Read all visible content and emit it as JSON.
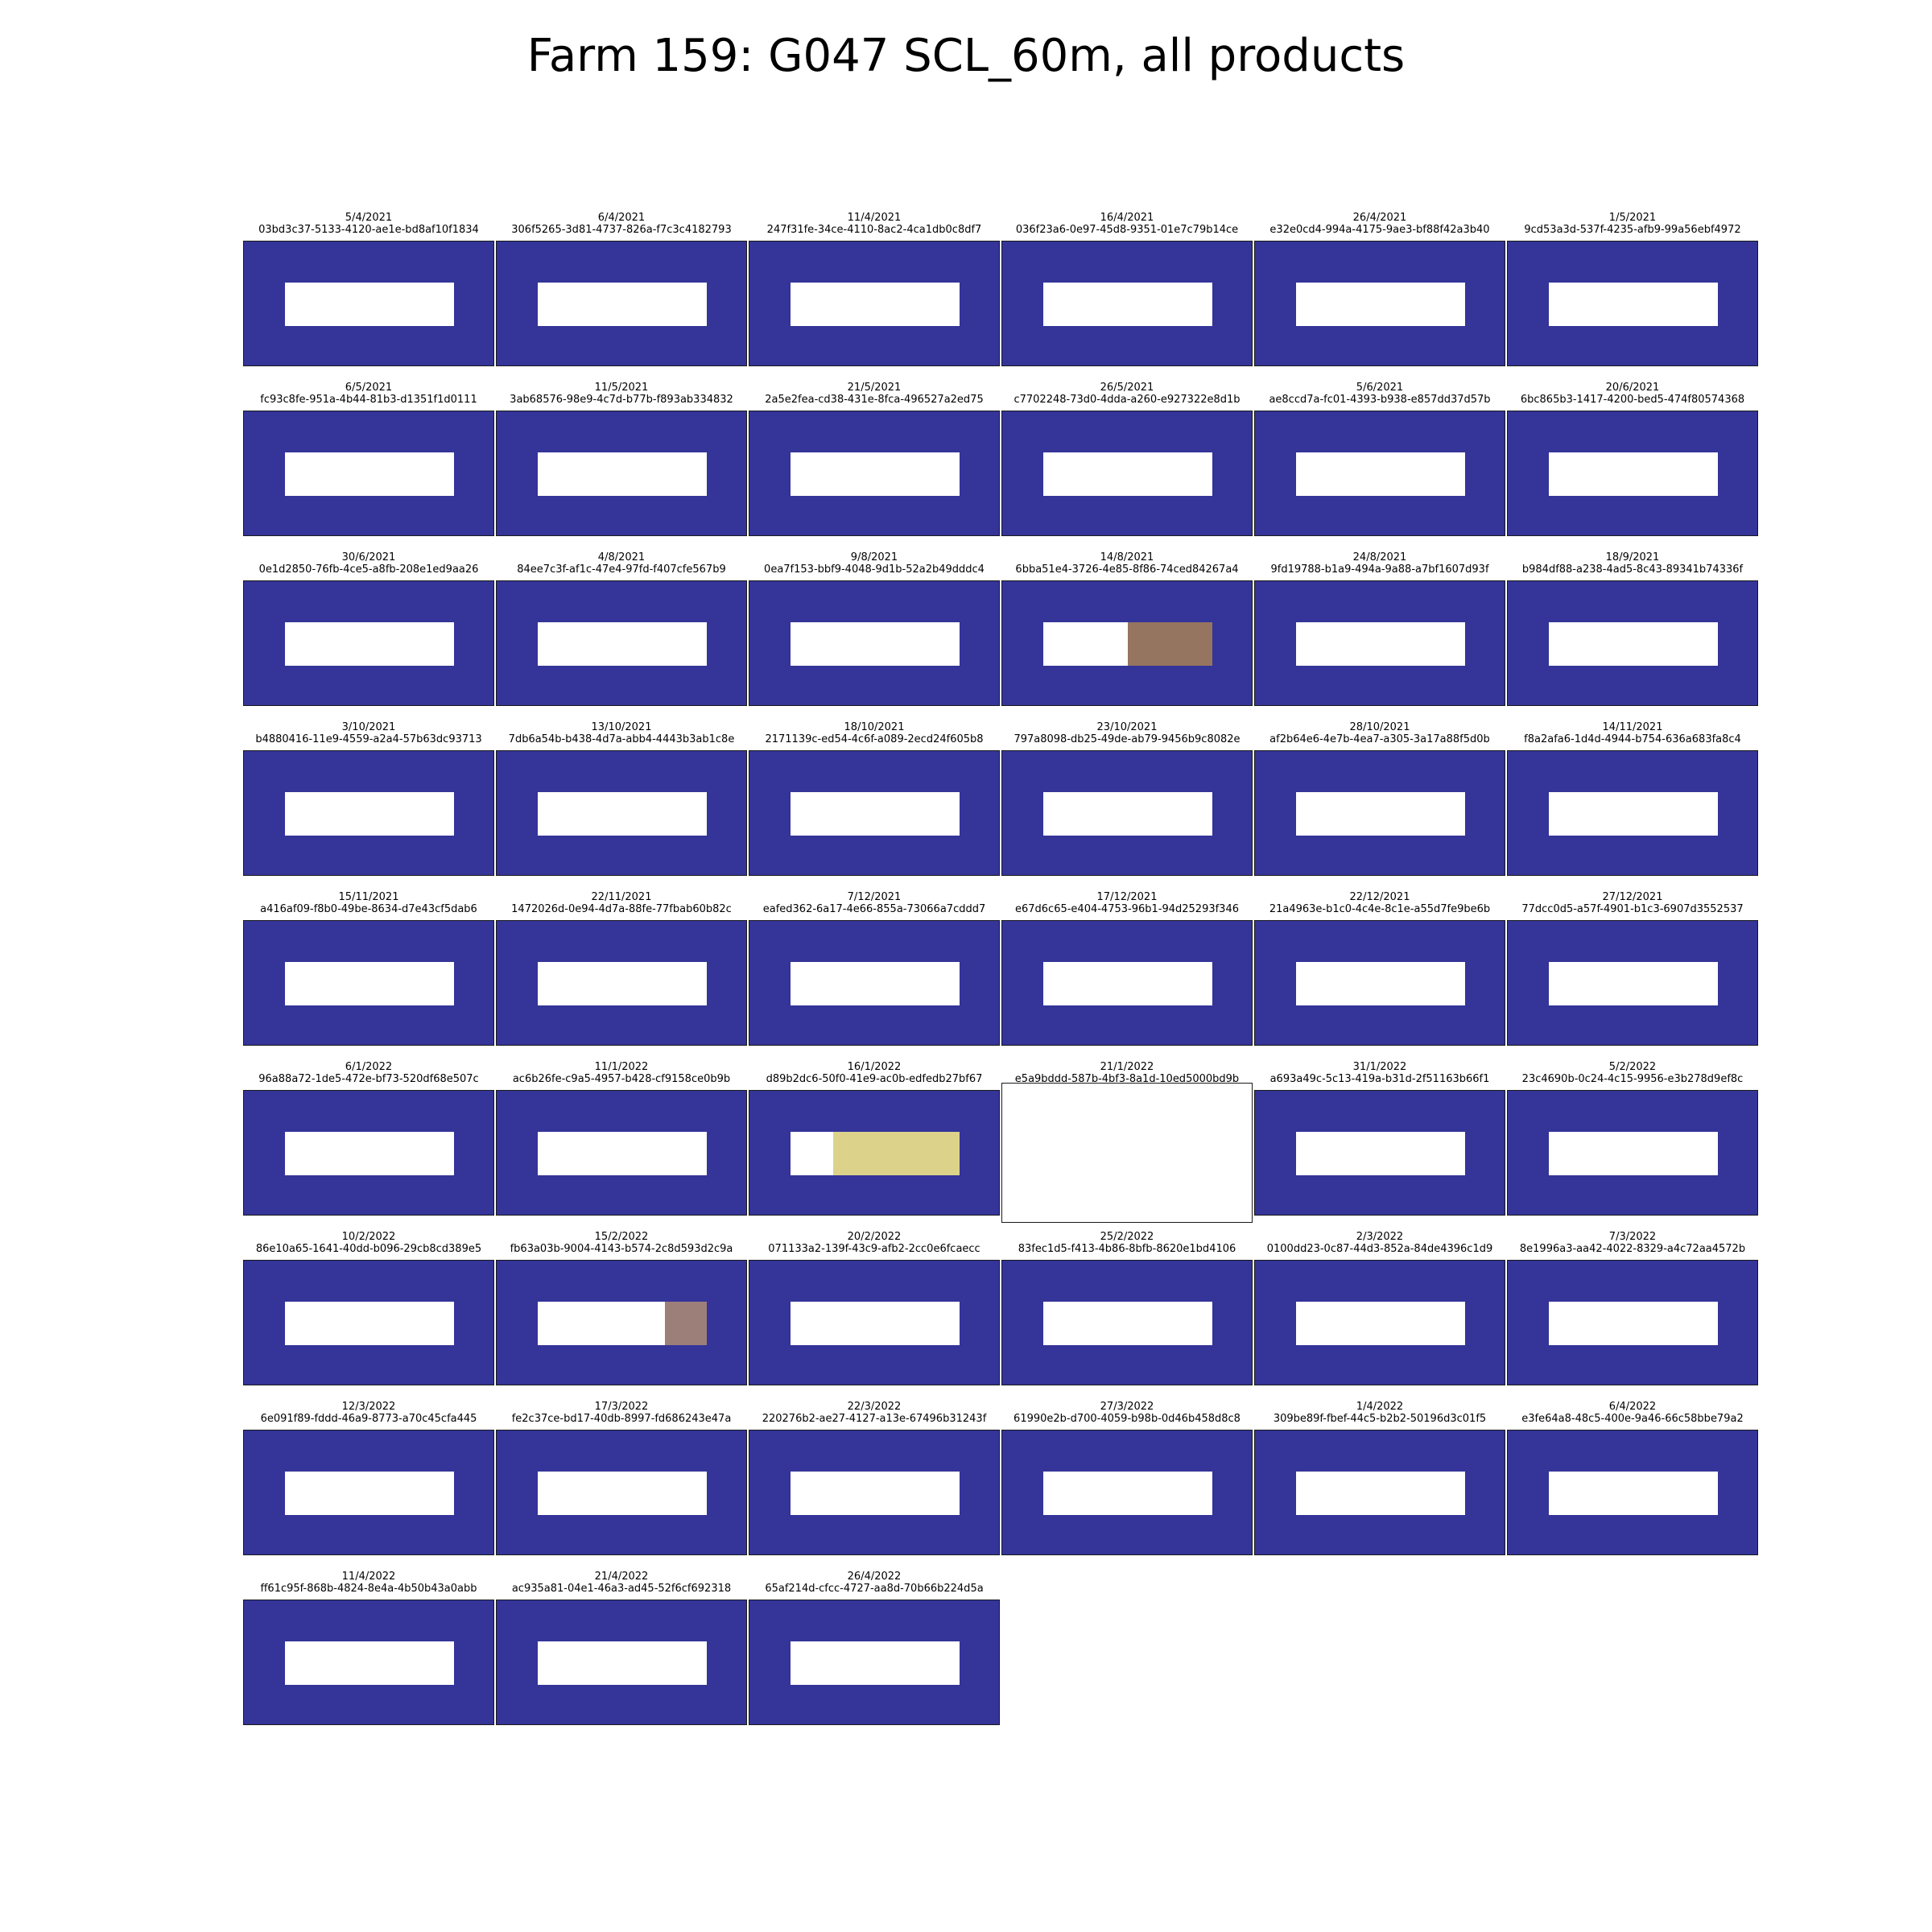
{
  "title": "Farm 159: G047 SCL_60m, all products",
  "chart_data": {
    "type": "image_grid",
    "title": "Farm 159: G047 SCL_60m, all products",
    "columns": 6,
    "colors": {
      "water": "#343499",
      "unclassified": "#ffffff",
      "bare_soil": "#967560",
      "cloud_shadow": "#dcd28a",
      "mixed_soil": "#9d7f7a"
    },
    "panels": [
      {
        "date": "5/4/2021",
        "id": "03bd3c37-5133-4120-ae1e-bd8af10f1834"
      },
      {
        "date": "6/4/2021",
        "id": "306f5265-3d81-4737-826a-f7c3c4182793"
      },
      {
        "date": "11/4/2021",
        "id": "247f31fe-34ce-4110-8ac2-4ca1db0c8df7"
      },
      {
        "date": "16/4/2021",
        "id": "036f23a6-0e97-45d8-9351-01e7c79b14ce"
      },
      {
        "date": "26/4/2021",
        "id": "e32e0cd4-994a-4175-9ae3-bf88f42a3b40"
      },
      {
        "date": "1/5/2021",
        "id": "9cd53a3d-537f-4235-afb9-99a56ebf4972"
      },
      {
        "date": "6/5/2021",
        "id": "fc93c8fe-951a-4b44-81b3-d1351f1d0111"
      },
      {
        "date": "11/5/2021",
        "id": "3ab68576-98e9-4c7d-b77b-f893ab334832"
      },
      {
        "date": "21/5/2021",
        "id": "2a5e2fea-cd38-431e-8fca-496527a2ed75"
      },
      {
        "date": "26/5/2021",
        "id": "c7702248-73d0-4dda-a260-e927322e8d1b"
      },
      {
        "date": "5/6/2021",
        "id": "ae8ccd7a-fc01-4393-b938-e857dd37d57b"
      },
      {
        "date": "20/6/2021",
        "id": "6bc865b3-1417-4200-bed5-474f80574368"
      },
      {
        "date": "30/6/2021",
        "id": "0e1d2850-76fb-4ce5-a8fb-208e1ed9aa26"
      },
      {
        "date": "4/8/2021",
        "id": "84ee7c3f-af1c-47e4-97fd-f407cfe567b9"
      },
      {
        "date": "9/8/2021",
        "id": "0ea7f153-bbf9-4048-9d1b-52a2b49dddc4"
      },
      {
        "date": "14/8/2021",
        "id": "6bba51e4-3726-4e85-8f86-74ced84267a4",
        "patch": {
          "start": 0.5,
          "end": 1.0,
          "color": "bare_soil"
        }
      },
      {
        "date": "24/8/2021",
        "id": "9fd19788-b1a9-494a-9a88-a7bf1607d93f"
      },
      {
        "date": "18/9/2021",
        "id": "b984df88-a238-4ad5-8c43-89341b74336f"
      },
      {
        "date": "3/10/2021",
        "id": "b4880416-11e9-4559-a2a4-57b63dc93713"
      },
      {
        "date": "13/10/2021",
        "id": "7db6a54b-b438-4d7a-abb4-4443b3ab1c8e"
      },
      {
        "date": "18/10/2021",
        "id": "2171139c-ed54-4c6f-a089-2ecd24f605b8"
      },
      {
        "date": "23/10/2021",
        "id": "797a8098-db25-49de-ab79-9456b9c8082e"
      },
      {
        "date": "28/10/2021",
        "id": "af2b64e6-4e7b-4ea7-a305-3a17a88f5d0b"
      },
      {
        "date": "14/11/2021",
        "id": "f8a2afa6-1d4d-4944-b754-636a683fa8c4"
      },
      {
        "date": "15/11/2021",
        "id": "a416af09-f8b0-49be-8634-d7e43cf5dab6"
      },
      {
        "date": "22/11/2021",
        "id": "1472026d-0e94-4d7a-88fe-77fbab60b82c"
      },
      {
        "date": "7/12/2021",
        "id": "eafed362-6a17-4e66-855a-73066a7cddd7"
      },
      {
        "date": "17/12/2021",
        "id": "e67d6c65-e404-4753-96b1-94d25293f346"
      },
      {
        "date": "22/12/2021",
        "id": "21a4963e-b1c0-4c4e-8c1e-a55d7fe9be6b"
      },
      {
        "date": "27/12/2021",
        "id": "77dcc0d5-a57f-4901-b1c3-6907d3552537"
      },
      {
        "date": "6/1/2022",
        "id": "96a88a72-1de5-472e-bf73-520df68e507c"
      },
      {
        "date": "11/1/2022",
        "id": "ac6b26fe-c9a5-4957-b428-cf9158ce0b9b"
      },
      {
        "date": "16/1/2022",
        "id": "d89b2dc6-50f0-41e9-ac0b-edfedb27bf67",
        "patch": {
          "start": 0.25,
          "end": 1.0,
          "color": "cloud_shadow"
        }
      },
      {
        "date": "21/1/2022",
        "id": "e5a9bddd-587b-4bf3-8a1d-10ed5000bd9b",
        "blank": true
      },
      {
        "date": "31/1/2022",
        "id": "a693a49c-5c13-419a-b31d-2f51163b66f1"
      },
      {
        "date": "5/2/2022",
        "id": "23c4690b-0c24-4c15-9956-e3b278d9ef8c"
      },
      {
        "date": "10/2/2022",
        "id": "86e10a65-1641-40dd-b096-29cb8cd389e5"
      },
      {
        "date": "15/2/2022",
        "id": "fb63a03b-9004-4143-b574-2c8d593d2c9a",
        "patch": {
          "start": 0.75,
          "end": 1.0,
          "color": "mixed_soil"
        }
      },
      {
        "date": "20/2/2022",
        "id": "071133a2-139f-43c9-afb2-2cc0e6fcaecc"
      },
      {
        "date": "25/2/2022",
        "id": "83fec1d5-f413-4b86-8bfb-8620e1bd4106"
      },
      {
        "date": "2/3/2022",
        "id": "0100dd23-0c87-44d3-852a-84de4396c1d9"
      },
      {
        "date": "7/3/2022",
        "id": "8e1996a3-aa42-4022-8329-a4c72aa4572b"
      },
      {
        "date": "12/3/2022",
        "id": "6e091f89-fddd-46a9-8773-a70c45cfa445"
      },
      {
        "date": "17/3/2022",
        "id": "fe2c37ce-bd17-40db-8997-fd686243e47a"
      },
      {
        "date": "22/3/2022",
        "id": "220276b2-ae27-4127-a13e-67496b31243f"
      },
      {
        "date": "27/3/2022",
        "id": "61990e2b-d700-4059-b98b-0d46b458d8c8"
      },
      {
        "date": "1/4/2022",
        "id": "309be89f-fbef-44c5-b2b2-50196d3c01f5"
      },
      {
        "date": "6/4/2022",
        "id": "e3fe64a8-48c5-400e-9a46-66c58bbe79a2"
      },
      {
        "date": "11/4/2022",
        "id": "ff61c95f-868b-4824-8e4a-4b50b43a0abb"
      },
      {
        "date": "21/4/2022",
        "id": "ac935a81-04e1-46a3-ad45-52f6cf692318"
      },
      {
        "date": "26/4/2022",
        "id": "65af214d-cfcc-4727-aa8d-70b66b224d5a"
      }
    ]
  }
}
